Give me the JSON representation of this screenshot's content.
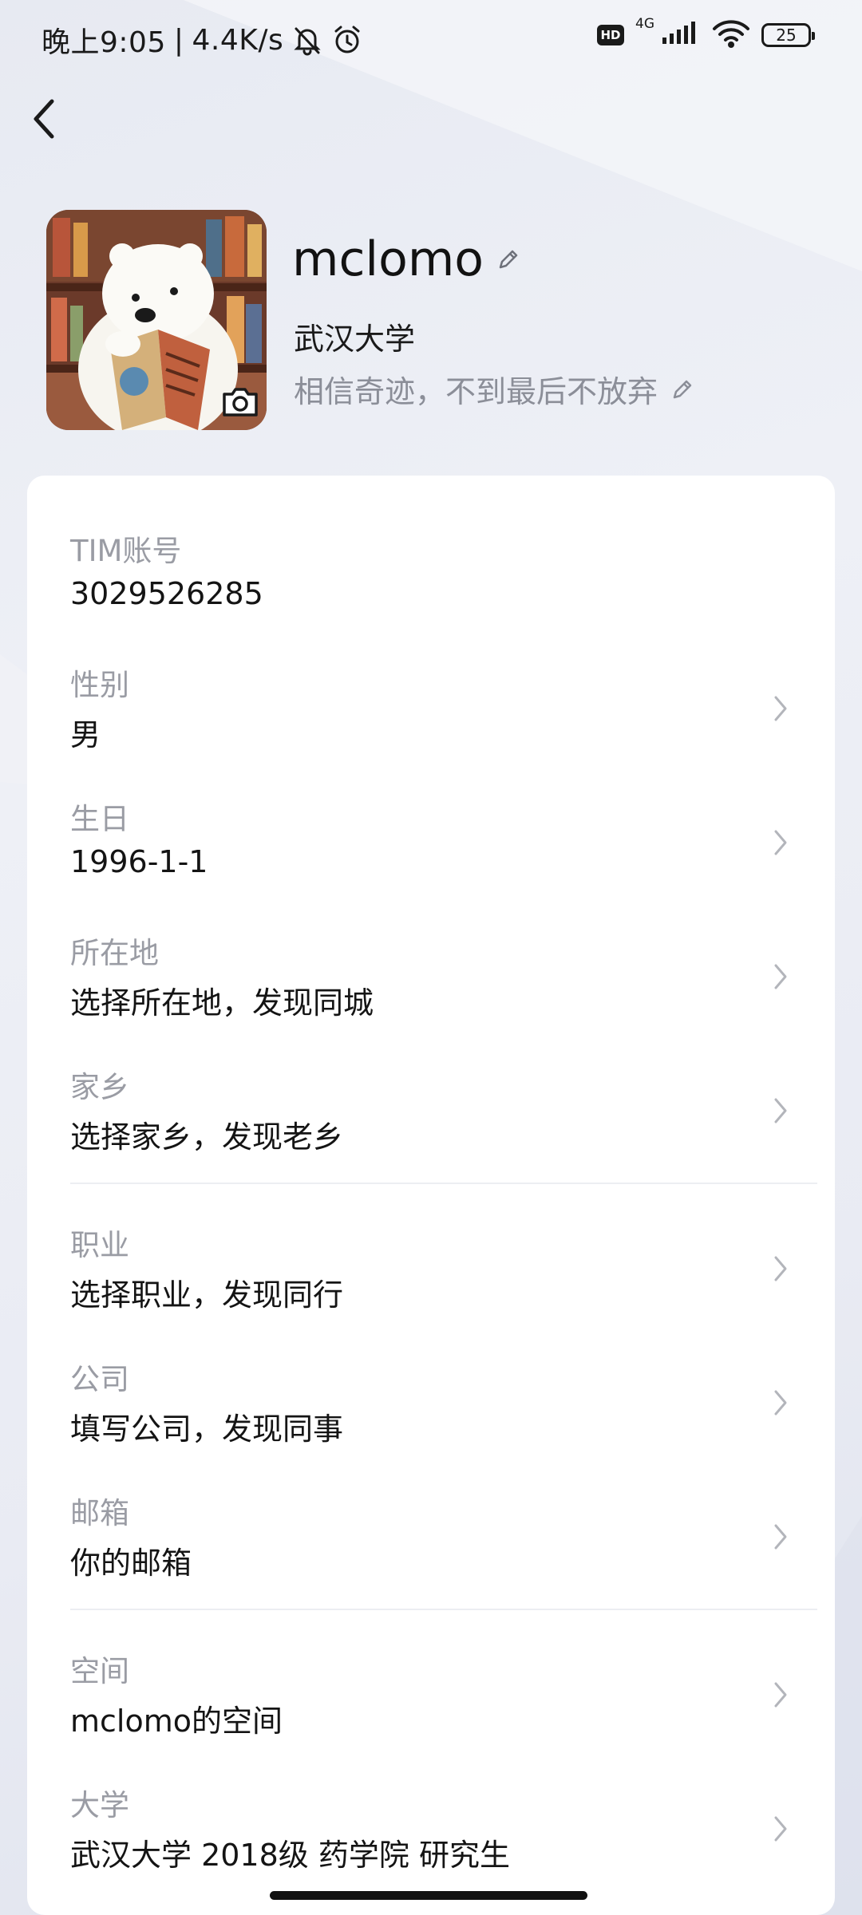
{
  "status_bar": {
    "time": "晚上9:05",
    "separator": "|",
    "net_speed": "4.4K/s",
    "hd": "HD",
    "network_type": "4G",
    "battery": "25"
  },
  "profile": {
    "nickname": "mclomo",
    "school": "武汉大学",
    "signature": "相信奇迹，不到最后不放弃"
  },
  "fields": [
    {
      "label": "TIM账号",
      "value": "3029526285"
    },
    {
      "label": "性别",
      "value": "男"
    },
    {
      "label": "生日",
      "value": "1996-1-1"
    },
    {
      "label": "所在地",
      "value": "选择所在地，发现同城"
    },
    {
      "label": "家乡",
      "value": "选择家乡，发现老乡"
    },
    {
      "label": "职业",
      "value": "选择职业，发现同行"
    },
    {
      "label": "公司",
      "value": "填写公司，发现同事"
    },
    {
      "label": "邮箱",
      "value": "你的邮箱"
    },
    {
      "label": "空间",
      "value": "mclomo的空间"
    },
    {
      "label": "大学",
      "value": "武汉大学 2018级  药学院 研究生"
    }
  ],
  "icons": {
    "back": "chevron-left-icon",
    "edit": "pencil-icon",
    "camera": "camera-icon",
    "row_arrow": "chevron-right-icon",
    "mute": "bell-off-icon",
    "alarm": "alarm-clock-icon",
    "signal": "signal-bars-icon",
    "wifi": "wifi-icon"
  },
  "colors": {
    "label": "#9a9ca4",
    "value": "#141414",
    "signature": "#8b8e98",
    "card": "#ffffff",
    "background": "#eceef5"
  }
}
